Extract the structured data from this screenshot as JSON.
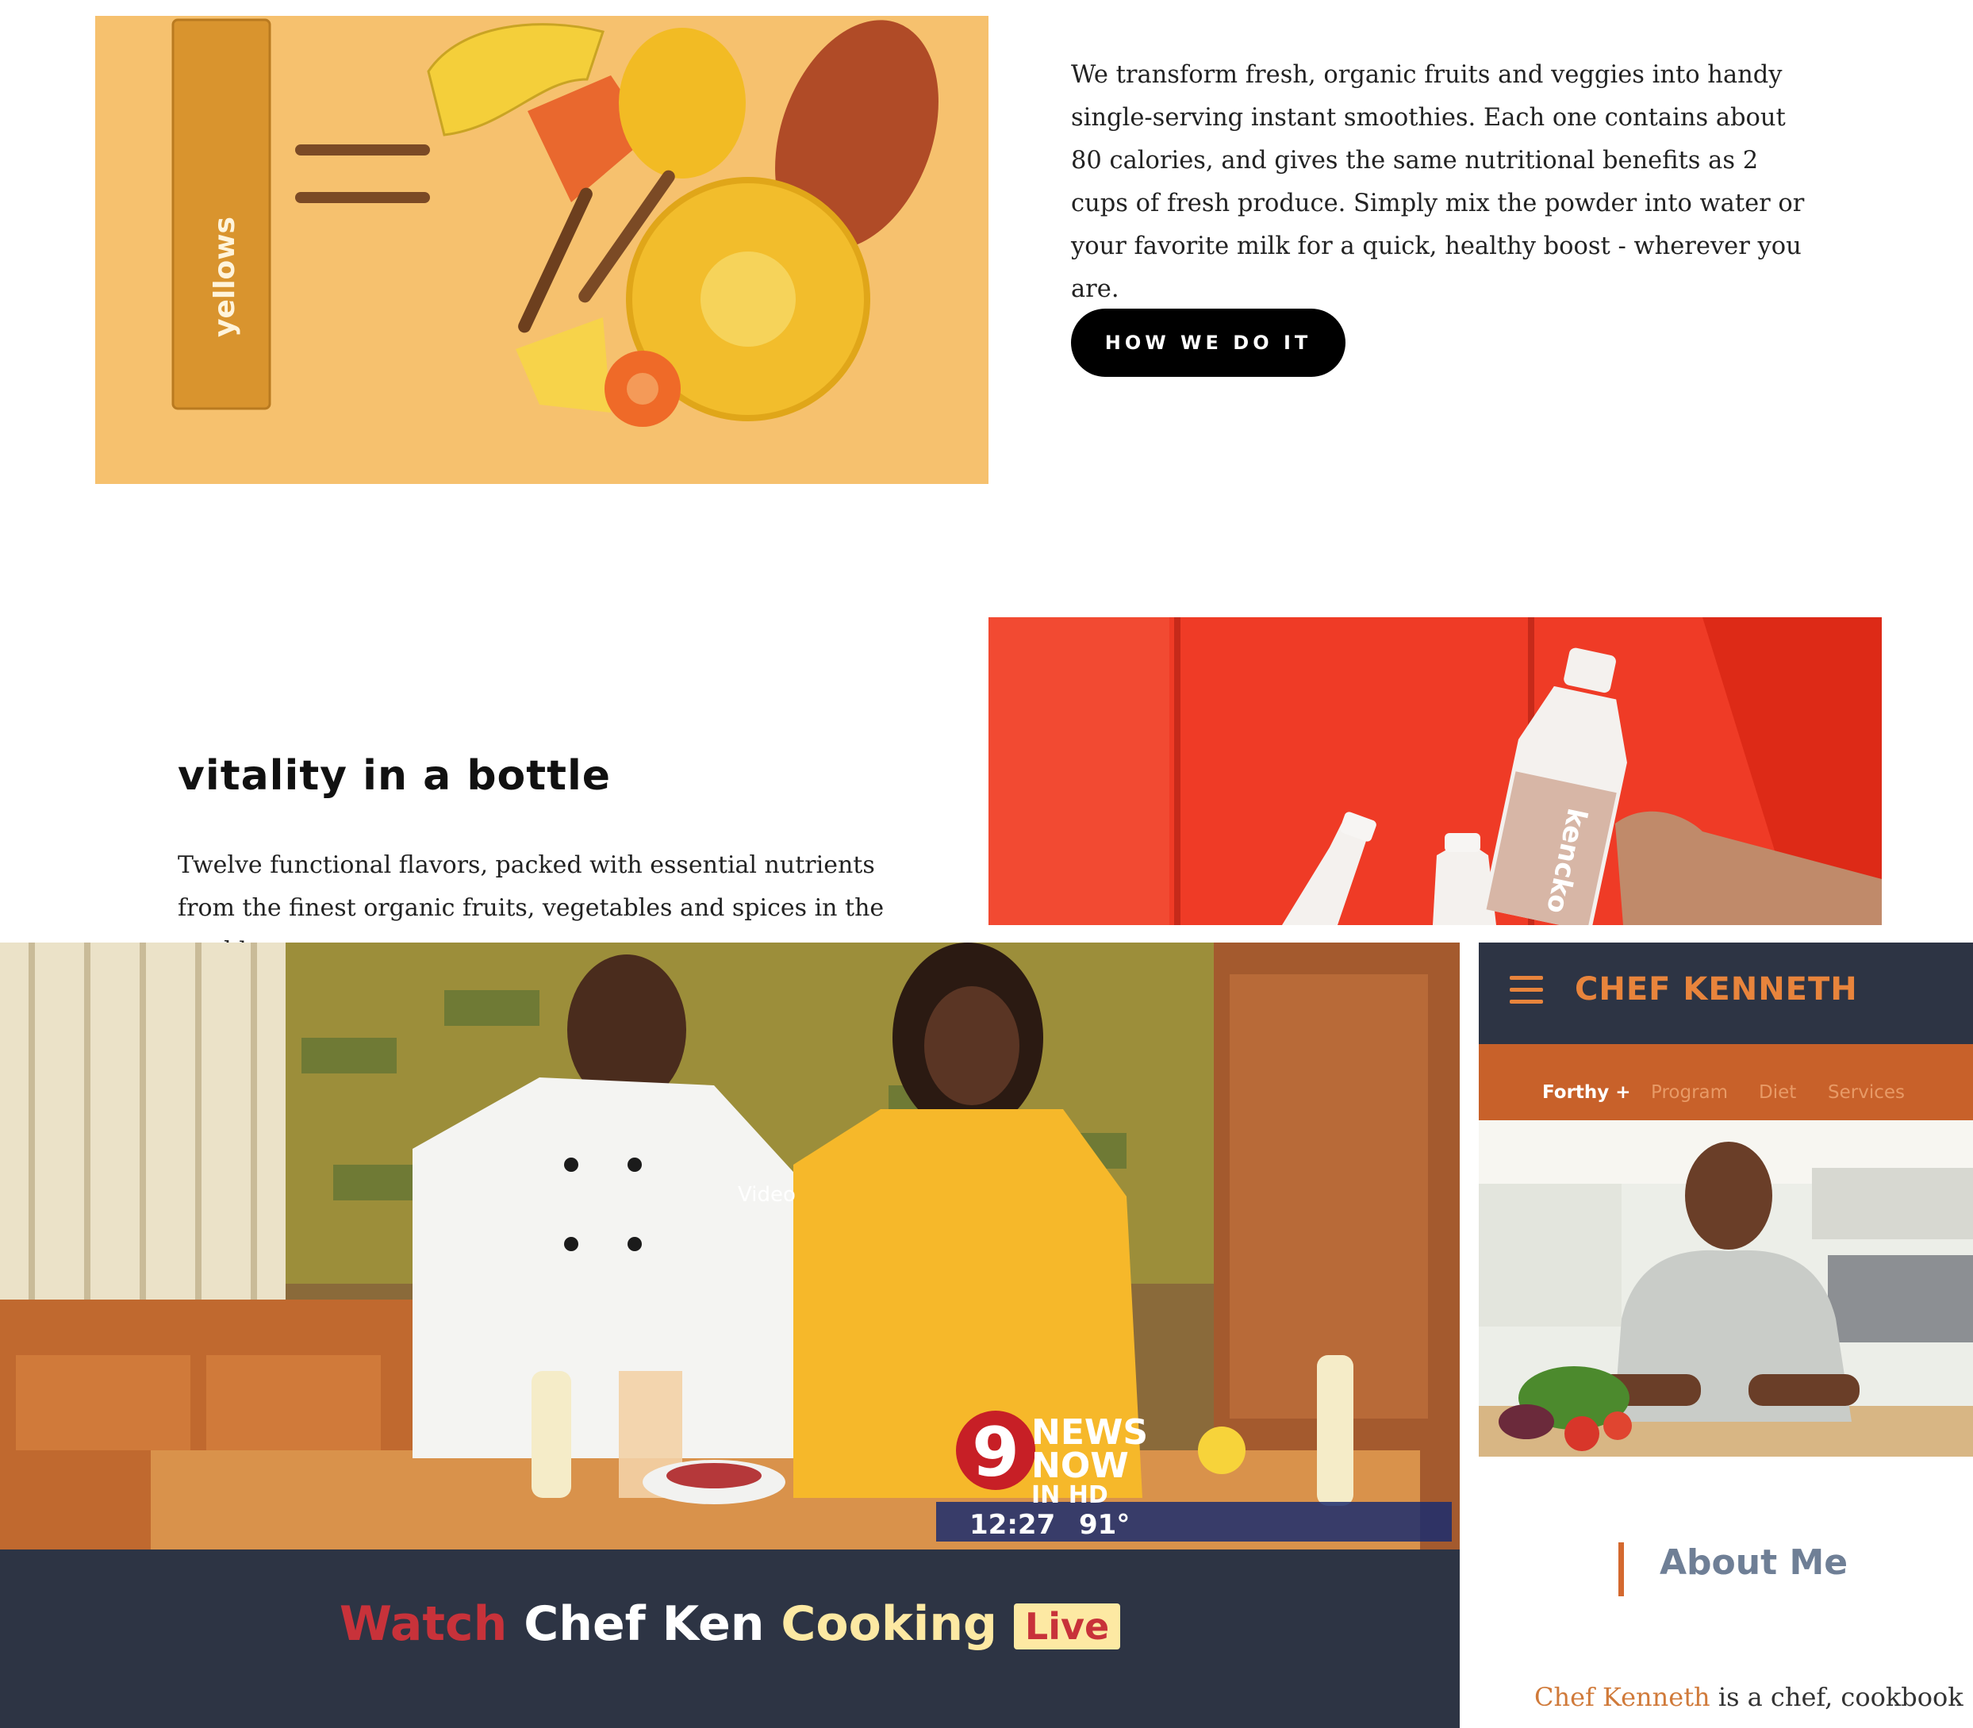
{
  "intro": {
    "paragraph": "We transform fresh, organic fruits and veggies into handy single-serving instant smoothies. Each one contains about 80 calories, and gives the same nutritional benefits as 2 cups of fresh produce. Simply mix the powder into water or your favorite milk for a quick, healthy boost - wherever you are.",
    "button_label": "HOW WE DO IT",
    "packet_label": "yellows"
  },
  "vitality": {
    "title": "vitality in a bottle",
    "description": "Twelve functional flavors, packed with essential nutrients from the finest organic fruits, vegetables and spices in the world.",
    "bottle_label": "kencko"
  },
  "video": {
    "overlay_text": "Video",
    "news_logo_number": "9",
    "news_logo_line1": "NEWS",
    "news_logo_line2": "NOW",
    "news_logo_line3": "IN HD",
    "news_time": "12:27",
    "news_temp": "91°"
  },
  "watch": {
    "word1": "Watch",
    "word2": "Chef Ken",
    "word3": "Cooking",
    "badge": "Live"
  },
  "mobile": {
    "brand": "CHEF KENNETH",
    "nav": [
      "Forthy +",
      "Program",
      "Diet",
      "Services"
    ],
    "about_title": "About Me",
    "bio_name": "Chef Kenneth",
    "bio_rest": " is a chef, cookbook"
  },
  "colors": {
    "peach_bg": "#f6c16e",
    "red_bg": "#ef3b26",
    "navy": "#2d3444",
    "orange_nav": "#c8612a",
    "brand_orange": "#e8843c",
    "watch_red": "#c8323a",
    "watch_yellow": "#fde9a3"
  }
}
